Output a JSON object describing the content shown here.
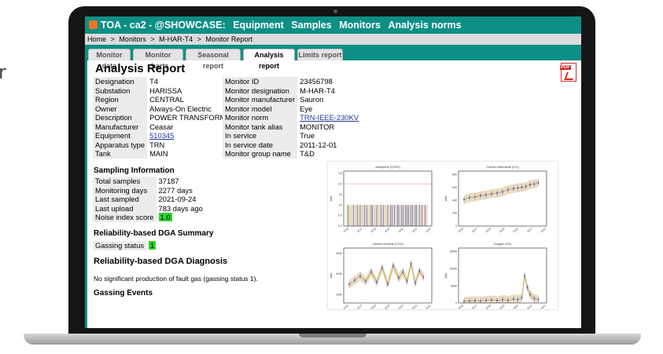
{
  "window": {
    "app_title": "TOA - ca2 - @SHOWCASE:",
    "menu": [
      "Equipment",
      "Samples",
      "Monitors",
      "Analysis norms"
    ]
  },
  "breadcrumb": [
    "Home",
    ">",
    "Monitors",
    ">",
    "M-HAR-T4",
    ">",
    "Monitor Report"
  ],
  "tabs": [
    {
      "label": "Monitor data",
      "active": false
    },
    {
      "label": "Monitor charts",
      "active": false
    },
    {
      "label": "Seasonal report",
      "active": false
    },
    {
      "label": "Analysis report",
      "active": true
    },
    {
      "label": "Limits report",
      "active": false
    }
  ],
  "report": {
    "title": "Analysis Report",
    "pdf_icon_label": "PDF",
    "left_rows": [
      {
        "key": "Designation",
        "value": "T4"
      },
      {
        "key": "Substation",
        "value": "HARISSA"
      },
      {
        "key": "Region",
        "value": "CENTRAL"
      },
      {
        "key": "Owner",
        "value": "Always-On Electric"
      },
      {
        "key": "Description",
        "value": "POWER TRANSFORMER"
      },
      {
        "key": "Manufacturer",
        "value": "Ceasar"
      },
      {
        "key": "Equipment",
        "value": "510345"
      },
      {
        "key": "Apparatus type",
        "value": "TRN"
      },
      {
        "key": "Tank",
        "value": "MAIN"
      }
    ],
    "right_rows": [
      {
        "key": "Monitor ID",
        "value": "23456798"
      },
      {
        "key": "Monitor designation",
        "value": "M-HAR-T4"
      },
      {
        "key": "Monitor manufacturer",
        "value": "Sauron"
      },
      {
        "key": "Monitor model",
        "value": "Eye"
      },
      {
        "key": "Monitor norm",
        "value": "TRN-IEEE-230KV"
      },
      {
        "key": "Monitor tank alias",
        "value": "MONITOR"
      },
      {
        "key": "In service",
        "value": "True"
      },
      {
        "key": "In service date",
        "value": "2011-12-01"
      },
      {
        "key": "Monitor group name",
        "value": "T&D"
      }
    ],
    "sampling": {
      "heading": "Sampling Information",
      "rows": [
        {
          "key": "Total samples",
          "value": "37187"
        },
        {
          "key": "Monitoring days",
          "value": "2277 days"
        },
        {
          "key": "Last sampled",
          "value": "2021-09-24"
        },
        {
          "key": "Last upload",
          "value": "783 days ago"
        },
        {
          "key": "Noise index score",
          "value": "1.0"
        }
      ]
    },
    "dga_summary": {
      "heading": "Reliability-based DGA Summary",
      "gassing_label": "Gassing status",
      "gassing_value": "1"
    },
    "dga_diagnosis": {
      "heading": "Reliability-based DGA Diagnosis",
      "text": "No significant production of fault gas (gassing status 1)."
    },
    "gassing_events_heading": "Gassing Events"
  },
  "background_glyph": "r",
  "colors": {
    "teal": "#0d8f86",
    "badge_green": "#2fd22f",
    "series_blue": "#2a3fd1",
    "band_tan": "#d9c08e",
    "limit_red": "#e33"
  },
  "chart_data": [
    {
      "type": "bar",
      "title": "Acetylene (C2H2)",
      "ylabel": "ppm",
      "x_ticks": [
        "2016",
        "2017",
        "2018",
        "2019",
        "2020",
        "2021",
        "2022"
      ],
      "y_ticks": [
        "0.0",
        "0.5",
        "1.0",
        "1.5",
        "2.0",
        "2.5"
      ],
      "ylim": [
        0,
        2.6
      ],
      "limit": 2.0,
      "x": [
        2016.1,
        2016.5,
        2016.8,
        2017.0,
        2017.3,
        2017.5,
        2017.8,
        2017.9,
        2018.2,
        2018.5,
        2018.7,
        2019.0,
        2019.2,
        2019.3,
        2019.5,
        2019.7,
        2019.8,
        2020.0,
        2020.1,
        2020.3,
        2020.4,
        2020.5,
        2020.7,
        2020.8,
        2021.0,
        2021.1,
        2021.3,
        2021.5,
        2021.7
      ],
      "values_level": 1.0
    },
    {
      "type": "line",
      "title": "Carbon Monoxide (CO)",
      "ylabel": "ppm",
      "x_ticks": [
        "2016",
        "2017",
        "2018",
        "2019",
        "2020",
        "2021",
        "2022"
      ],
      "y_ticks": [
        "0",
        "200",
        "400",
        "600",
        "800"
      ],
      "ylim": [
        0,
        850
      ],
      "series": [
        {
          "name": "",
          "x": [
            2016.2,
            2016.6,
            2017.0,
            2017.4,
            2017.8,
            2018.2,
            2018.6,
            2019.0,
            2019.4,
            2019.8,
            2020.1,
            2020.4,
            2020.7,
            2021.0,
            2021.3,
            2021.6
          ],
          "y": [
            410,
            440,
            450,
            470,
            480,
            500,
            510,
            530,
            560,
            580,
            590,
            600,
            610,
            640,
            650,
            670
          ]
        }
      ]
    },
    {
      "type": "line",
      "title": "Carbon Dioxide (CO2)",
      "ylabel": "ppm",
      "x_ticks": [
        "2016",
        "2017",
        "2018",
        "2019",
        "2020",
        "2021",
        "2022"
      ],
      "y_ticks": [
        "2000",
        "4000",
        "6000"
      ],
      "ylim": [
        1200,
        6500
      ],
      "series": [
        {
          "name": "",
          "x": [
            2016.2,
            2016.6,
            2017.0,
            2017.4,
            2017.8,
            2018.2,
            2018.6,
            2019.0,
            2019.4,
            2019.8,
            2020.1,
            2020.4,
            2020.7,
            2021.0,
            2021.3,
            2021.6
          ],
          "y": [
            3000,
            3400,
            3800,
            3300,
            4200,
            3200,
            4600,
            3000,
            4800,
            3600,
            4200,
            3300,
            5000,
            3100,
            4300,
            3700
          ]
        }
      ]
    },
    {
      "type": "line",
      "title": "Oxygen (O2)",
      "ylabel": "ppm",
      "x_ticks": [
        "2016",
        "2017",
        "2018",
        "2019",
        "2020",
        "2021",
        "2022"
      ],
      "y_ticks": [
        "0",
        "5000",
        "10000",
        "15000"
      ],
      "ylim": [
        0,
        16000
      ],
      "series": [
        {
          "name": "",
          "x": [
            2016.2,
            2016.6,
            2017.0,
            2017.4,
            2017.8,
            2018.2,
            2018.6,
            2019.0,
            2019.4,
            2019.8,
            2020.1,
            2020.4,
            2020.6,
            2020.8,
            2021.0,
            2021.3,
            2021.6
          ],
          "y": [
            500,
            600,
            700,
            600,
            800,
            900,
            700,
            1000,
            800,
            1200,
            1000,
            1500,
            8000,
            4500,
            2500,
            1300,
            1000
          ]
        }
      ]
    }
  ]
}
